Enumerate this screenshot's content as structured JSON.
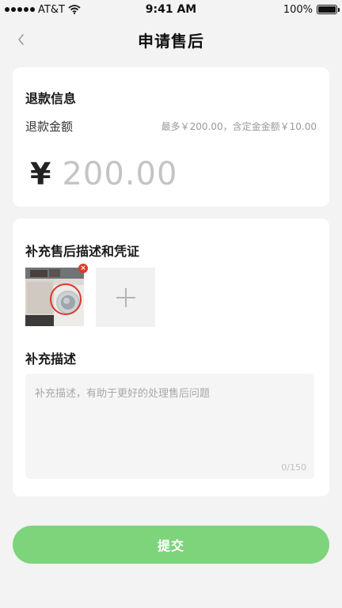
{
  "status_bar": {
    "carrier": "AT&T",
    "time": "9:41 AM",
    "battery": "100%"
  },
  "nav": {
    "title": "申请售后"
  },
  "refund": {
    "section_title": "退款信息",
    "amount_label": "退款金额",
    "amount_hint": "最多￥200.00，含定金金额￥10.00",
    "currency_symbol": "¥",
    "amount_value": "200.00"
  },
  "evidence": {
    "section_title": "补充售后描述和凭证",
    "photo_count": 1,
    "supplement_title": "补充描述",
    "description_placeholder": "补充描述，有助于更好的处理售后问题",
    "char_counter": "0/150"
  },
  "actions": {
    "submit_label": "提交"
  },
  "colors": {
    "accent_green": "#7dd47b",
    "background": "#f3f3f3",
    "remove_badge": "#d93a2c"
  },
  "icons": {
    "back": "chevron-left-icon",
    "add_photo": "plus-icon",
    "remove": "close-icon",
    "wifi": "wifi-icon",
    "battery": "battery-icon"
  }
}
